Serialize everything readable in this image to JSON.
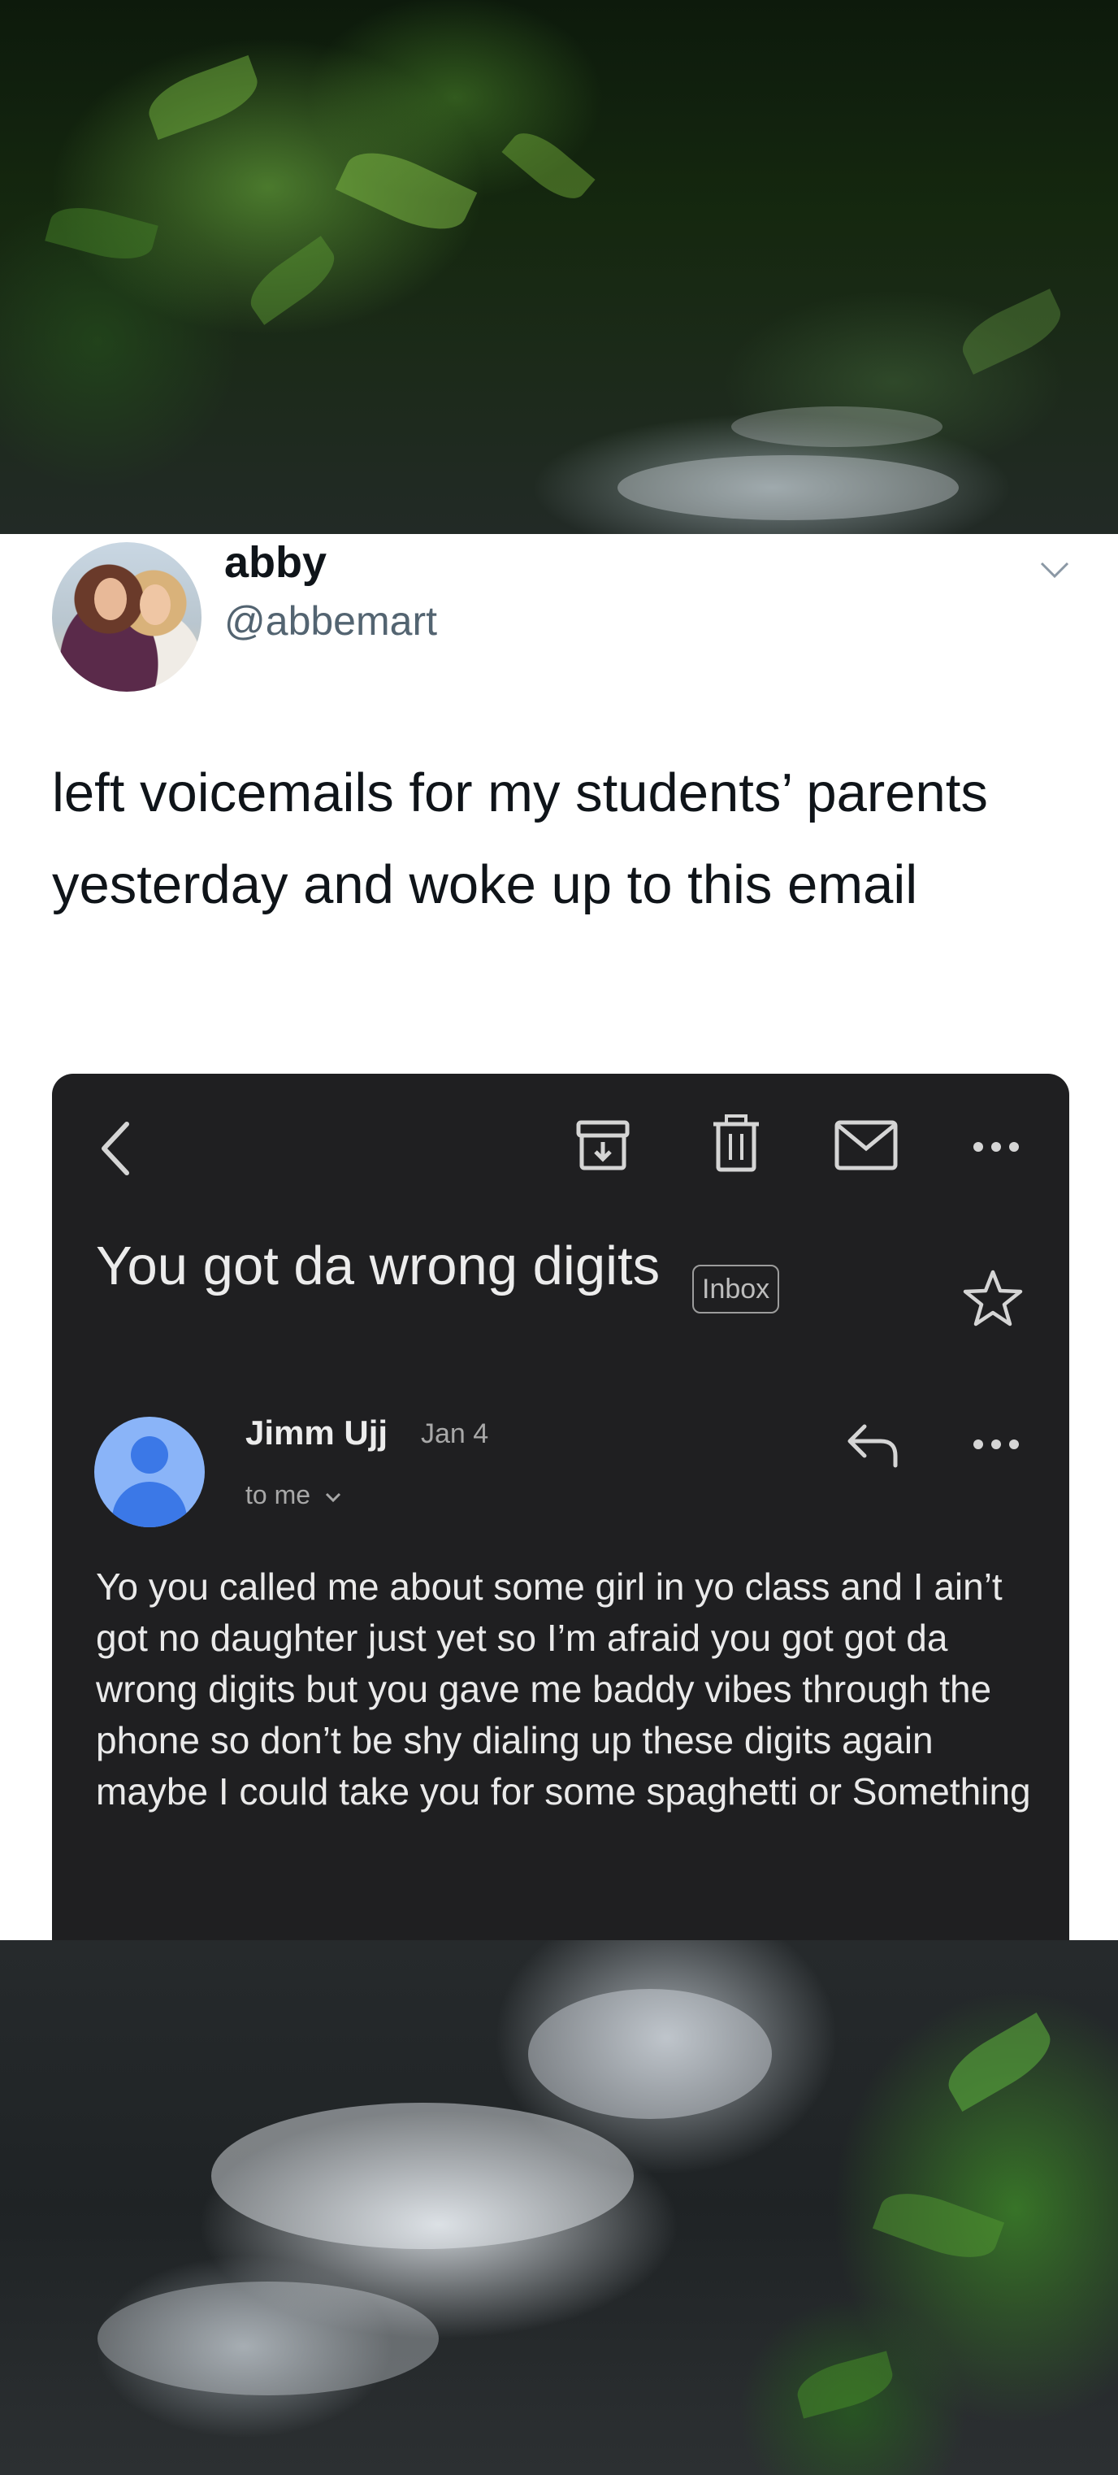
{
  "tweet": {
    "display_name": "abby",
    "handle": "@abbemart",
    "text": "left voicemails for my students’ parents yesterday and woke up to this email",
    "menu_icon": "chevron-down-icon"
  },
  "email": {
    "subject": "You got da wrong digits",
    "label": "Inbox",
    "sender_name": "Jimm Ujj",
    "date": "Jan 4",
    "recipient": "to me",
    "body": "Yo you called me about some girl in yo class and I ain’t got no daughter just yet so I’m afraid you got got da wrong digits but you gave me baddy vibes through the phone so don’t be shy dialing up these digits again maybe I could take you for some spaghetti or Something",
    "toolbar_icons": [
      "back-arrow-icon",
      "archive-icon",
      "trash-icon",
      "mail-icon",
      "more-icon"
    ],
    "colors": {
      "background": "#1f1f21",
      "text": "#eaeaea",
      "avatar": "#8ab4f8"
    }
  }
}
